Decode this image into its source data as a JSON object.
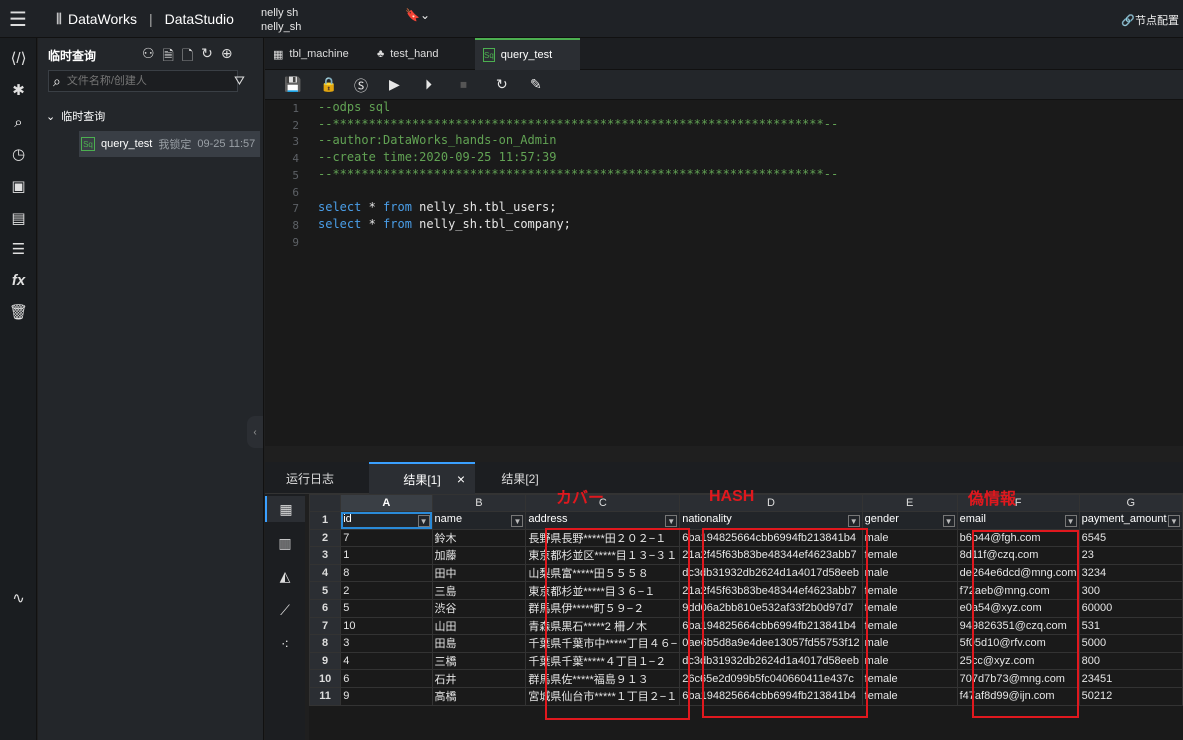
{
  "topbar": {
    "logo_text": "DataWorks",
    "product": "DataStudio",
    "workspace_line1": "nelly sh",
    "workspace_line2": "nelly_sh",
    "right_label": "节点配置"
  },
  "panel": {
    "title": "临时查询",
    "search_placeholder": "文件名称/创建人",
    "tree_root": "临时查询",
    "item": {
      "name": "query_test",
      "status": "我锁定",
      "time": "09-25 11:57"
    }
  },
  "tabs": [
    {
      "label": "tbl_machine",
      "icon": "table-icon"
    },
    {
      "label": "test_hand",
      "icon": "flow-icon"
    },
    {
      "label": "query_test",
      "icon": "sql-icon",
      "badge": "Sq"
    }
  ],
  "editor": {
    "line_numbers": [
      "1",
      "2",
      "3",
      "4",
      "5",
      "6",
      "7",
      "8",
      "9"
    ],
    "lines": [
      {
        "cls": "cm",
        "text": "--odps sql"
      },
      {
        "cls": "cm",
        "text": "--********************************************************************--"
      },
      {
        "cls": "cm",
        "text": "--author:DataWorks_hands-on_Admin"
      },
      {
        "cls": "cm",
        "text": "--create time:2020-09-25 11:57:39"
      },
      {
        "cls": "cm",
        "text": "--********************************************************************--"
      },
      {
        "cls": "tx",
        "text": ""
      },
      {
        "cls": "sql",
        "kw1": "select",
        "mid": " * ",
        "kw2": "from",
        "rest": " nelly_sh.tbl_users;"
      },
      {
        "cls": "sql",
        "kw1": "select",
        "mid": " * ",
        "kw2": "from",
        "rest": " nelly_sh.tbl_company;"
      },
      {
        "cls": "tx",
        "text": ""
      }
    ]
  },
  "result_tabs": [
    "运行日志",
    "结果[1]",
    "结果[2]"
  ],
  "result_close": "×",
  "grid": {
    "col_letters": [
      "A",
      "B",
      "C",
      "D",
      "E",
      "F",
      "G"
    ],
    "headers": [
      "id",
      "name",
      "address",
      "nationality",
      "gender",
      "email",
      "payment_amount"
    ],
    "rows": [
      [
        "7",
        "鈴木",
        "長野県長野*****田２０２−１",
        "6ba194825664cbb6994fb213841b4",
        "male",
        "b6b44@fgh.com",
        "6545"
      ],
      [
        "1",
        "加藤",
        "東京都杉並区*****目１３−３１",
        "21a2f45f63b83be48344ef4623abb7",
        "female",
        "8d11f@czq.com",
        "23"
      ],
      [
        "8",
        "田中",
        "山梨県富*****田５５５８",
        "dc3db31932db2624d1a4017d58eeb",
        "male",
        "de264e6dcd@mng.com",
        "3234"
      ],
      [
        "2",
        "三島",
        "東京都杉並*****目３６−１",
        "21a2f45f63b83be48344ef4623abb7",
        "female",
        "f72aeb@mng.com",
        "300"
      ],
      [
        "5",
        "渋谷",
        "群馬県伊*****町５９−２",
        "9dd06a2bb810e532af33f2b0d97d7",
        "female",
        "e0a54@xyz.com",
        "60000"
      ],
      [
        "10",
        "山田",
        "青森県黒石*****2 柵ノ木",
        "6ba194825664cbb6994fb213841b4",
        "female",
        "949826351@czq.com",
        "531"
      ],
      [
        "3",
        "田島",
        "千葉県千葉市中*****丁目４６−",
        "0ae6b5d8a9e4dee13057fd55753f12",
        "male",
        "5f05d10@rfv.com",
        "5000"
      ],
      [
        "4",
        "三橋",
        "千葉県千葉*****４丁目１−２",
        "dc3db31932db2624d1a4017d58eeb",
        "male",
        "25cc@xyz.com",
        "800"
      ],
      [
        "6",
        "石井",
        "群馬県佐*****福島９１３",
        "26c65e2d099b5fc040660411e437c",
        "female",
        "707d7b73@mng.com",
        "23451"
      ],
      [
        "9",
        "高橋",
        "宮城県仙台市*****１丁目２−１",
        "6ba194825664cbb6994fb213841b4",
        "female",
        "f47af8d99@ijn.com",
        "50212"
      ]
    ]
  },
  "annotations": {
    "cover": "カバー",
    "hash": "HASH",
    "fake": "偽情報"
  },
  "colors": {
    "annotation_red": "#e0181e",
    "active_tab_green": "#4caf50",
    "active_result_blue": "#3aa0ff"
  }
}
